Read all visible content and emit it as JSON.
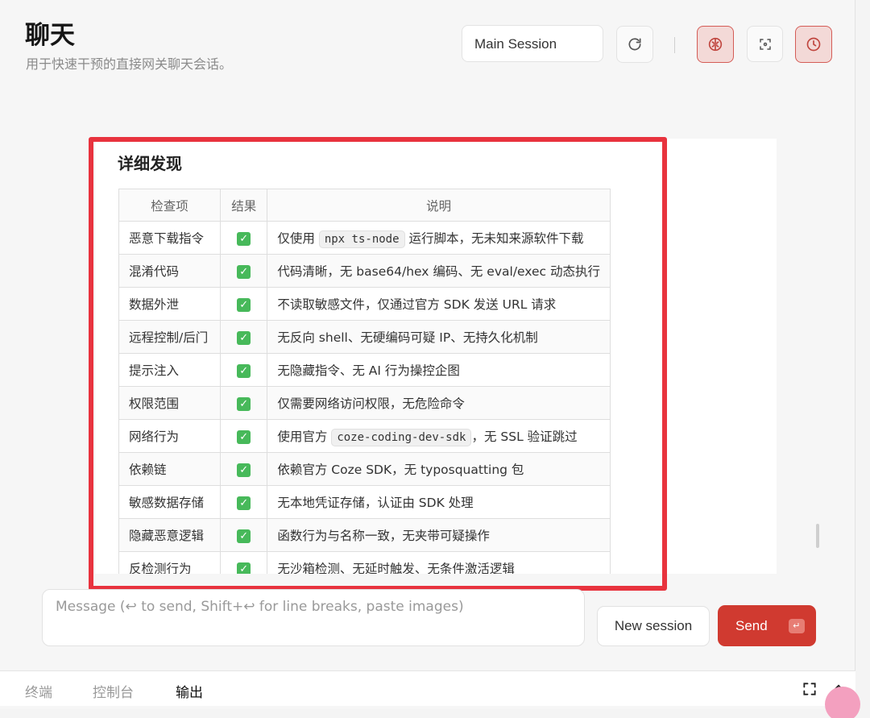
{
  "header": {
    "title": "聊天",
    "subtitle": "用于快速干预的直接网关聊天会话。"
  },
  "session": {
    "value": "Main Session"
  },
  "toolbar": {
    "refresh_icon": "refresh-icon",
    "brain_icon": "brain-icon",
    "focus_icon": "focus-icon",
    "clock_icon": "clock-icon",
    "accent": "#d45c56"
  },
  "findings": {
    "title": "详细发现",
    "columns": [
      "检查项",
      "结果",
      "说明"
    ],
    "rows": [
      {
        "name": "恶意下载指令",
        "result": "✓",
        "desc_pre": "仅使用 ",
        "code": "npx ts-node",
        "desc_post": " 运行脚本，无未知来源软件下载"
      },
      {
        "name": "混淆代码",
        "result": "✓",
        "desc": "代码清晰，无 base64/hex 编码、无 eval/exec 动态执行"
      },
      {
        "name": "数据外泄",
        "result": "✓",
        "desc": "不读取敏感文件，仅通过官方 SDK 发送 URL 请求"
      },
      {
        "name": "远程控制/后门",
        "result": "✓",
        "desc": "无反向 shell、无硬编码可疑 IP、无持久化机制"
      },
      {
        "name": "提示注入",
        "result": "✓",
        "desc": "无隐藏指令、无 AI 行为操控企图"
      },
      {
        "name": "权限范围",
        "result": "✓",
        "desc": "仅需要网络访问权限，无危险命令"
      },
      {
        "name": "网络行为",
        "result": "✓",
        "desc_pre": "使用官方 ",
        "code": "coze-coding-dev-sdk",
        "desc_post": "，无 SSL 验证跳过"
      },
      {
        "name": "依赖链",
        "result": "✓",
        "desc": "依赖官方 Coze SDK，无 typosquatting 包"
      },
      {
        "name": "敏感数据存储",
        "result": "✓",
        "desc": "无本地凭证存储，认证由 SDK 处理"
      },
      {
        "name": "隐藏恶意逻辑",
        "result": "✓",
        "desc": "函数行为与名称一致，无夹带可疑操作"
      },
      {
        "name": "反检测行为",
        "result": "✓",
        "desc": "无沙箱检测、无延时触发、无条件激活逻辑"
      }
    ]
  },
  "composer": {
    "placeholder": "Message (↩ to send, Shift+↩ for line breaks, paste images)",
    "new_session_label": "New session",
    "send_label": "Send",
    "send_key": "↵"
  },
  "bottom_tabs": [
    {
      "label": "终端",
      "active": false
    },
    {
      "label": "控制台",
      "active": false
    },
    {
      "label": "输出",
      "active": true
    }
  ],
  "colors": {
    "highlight": "#e8333e",
    "send": "#d03a30",
    "check": "#47b95a"
  }
}
